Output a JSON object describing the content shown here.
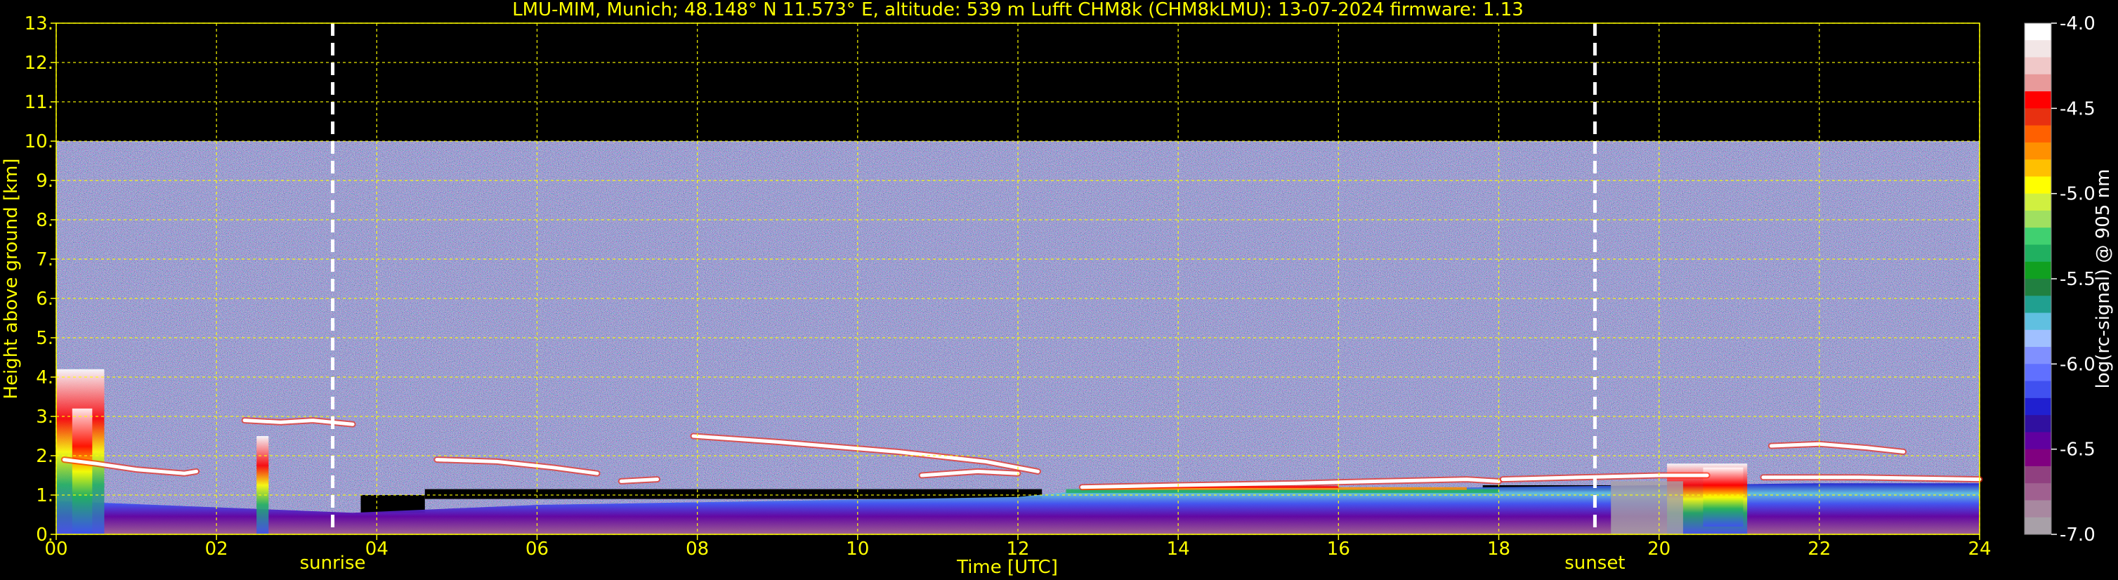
{
  "chart_data": {
    "type": "heatmap",
    "title": "LMU-MIM, Munich; 48.148° N 11.573° E, altitude: 539 m    Lufft CHM8k (CHM8kLMU): 13-07-2024    firmware: 1.13",
    "xlabel": "Time [UTC]",
    "ylabel": "Height above ground [km]",
    "xlim": [
      0,
      24
    ],
    "ylim": [
      0,
      13
    ],
    "x_ticks": [
      "00",
      "02",
      "04",
      "06",
      "08",
      "10",
      "12",
      "14",
      "16",
      "18",
      "20",
      "22",
      "24"
    ],
    "y_ticks": [
      "0.",
      "1.",
      "2.",
      "3.",
      "4.",
      "5.",
      "6.",
      "7.",
      "8.",
      "9.",
      "10.",
      "11.",
      "12.",
      "13."
    ],
    "grid": true,
    "data_top_km": 10,
    "events": [
      {
        "label": "sunrise",
        "time": 3.45
      },
      {
        "label": "sunset",
        "time": 19.2
      }
    ],
    "colorbar": {
      "label": "log(rc-signal) @ 905 nm",
      "range": [
        -7.0,
        -4.0
      ],
      "ticks": [
        "-4.0",
        "-4.5",
        "-5.0",
        "-5.5",
        "-6.0",
        "-6.5",
        "-7.0"
      ],
      "colors": [
        "#ffffff",
        "#f2e6e6",
        "#f0c8c8",
        "#e89a9a",
        "#ff0000",
        "#e83010",
        "#ff6000",
        "#ff9000",
        "#ffc000",
        "#ffff00",
        "#d0f040",
        "#a0e060",
        "#40d070",
        "#20b060",
        "#10a020",
        "#208040",
        "#20a090",
        "#60c0e0",
        "#a0c0ff",
        "#8090ff",
        "#6070ff",
        "#4050f0",
        "#2020d0",
        "#3010a0",
        "#6000a0",
        "#800080",
        "#904080",
        "#a06090",
        "#a888a0",
        "#a8a0a8"
      ]
    },
    "cloud_base_layers": [
      {
        "t": [
          0.1,
          0.5,
          1.0,
          1.6,
          1.75
        ],
        "h": [
          1.9,
          1.8,
          1.65,
          1.55,
          1.6
        ]
      },
      {
        "t": [
          2.35,
          2.8,
          3.2,
          3.7
        ],
        "h": [
          2.9,
          2.85,
          2.9,
          2.8
        ]
      },
      {
        "t": [
          4.75,
          5.5,
          6.2,
          6.75
        ],
        "h": [
          1.9,
          1.85,
          1.7,
          1.55
        ]
      },
      {
        "t": [
          7.05,
          7.5
        ],
        "h": [
          1.35,
          1.4
        ]
      },
      {
        "t": [
          7.95,
          9.0,
          10.5,
          11.6,
          12.25
        ],
        "h": [
          2.5,
          2.35,
          2.1,
          1.85,
          1.6
        ]
      },
      {
        "t": [
          10.8,
          11.5,
          12.0
        ],
        "h": [
          1.5,
          1.6,
          1.55
        ]
      },
      {
        "t": [
          12.8,
          14.0,
          15.5,
          16.5,
          17.6,
          18.0
        ],
        "h": [
          1.2,
          1.25,
          1.3,
          1.35,
          1.4,
          1.35
        ]
      },
      {
        "t": [
          18.05,
          19.0,
          20.0,
          20.6
        ],
        "h": [
          1.4,
          1.45,
          1.5,
          1.5
        ]
      },
      {
        "t": [
          21.4,
          22.0,
          22.6,
          23.05
        ],
        "h": [
          2.25,
          2.3,
          2.2,
          2.1
        ]
      },
      {
        "t": [
          21.3,
          22.5,
          24.0
        ],
        "h": [
          1.45,
          1.45,
          1.4
        ]
      }
    ],
    "boundary_layer": [
      {
        "t": 0.0,
        "h": 0.85,
        "v": -6.7
      },
      {
        "t": 3.7,
        "h": 0.55,
        "v": -6.5
      },
      {
        "t": 6.0,
        "h": 0.75,
        "v": -6.3
      },
      {
        "t": 9.0,
        "h": 0.85,
        "v": -6.2
      },
      {
        "t": 12.0,
        "h": 0.95,
        "v": -6.0
      },
      {
        "t": 13.0,
        "h": 1.15,
        "v": -5.6
      },
      {
        "t": 16.0,
        "h": 1.15,
        "v": -5.7
      },
      {
        "t": 18.0,
        "h": 1.2,
        "v": -5.8
      },
      {
        "t": 20.0,
        "h": 1.25,
        "v": -5.5
      },
      {
        "t": 22.0,
        "h": 1.3,
        "v": -6.0
      },
      {
        "t": 24.0,
        "h": 1.3,
        "v": -6.1
      }
    ]
  }
}
